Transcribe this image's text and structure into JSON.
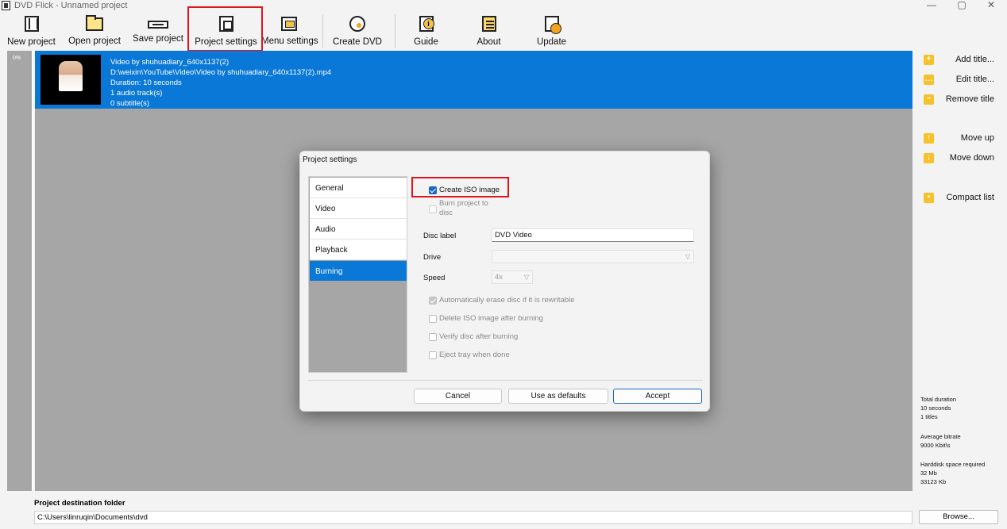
{
  "window": {
    "title": "DVD Flick - Unnamed project",
    "minimize": "—",
    "restore": "▢",
    "close": "✕"
  },
  "toolbar": {
    "new_project": "New project",
    "open_project": "Open project",
    "save_project": "Save project",
    "project_settings": "Project settings",
    "menu_settings": "Menu settings",
    "create_dvd": "Create DVD",
    "guide": "Guide",
    "about": "About",
    "update": "Update"
  },
  "progress": {
    "label": "0%",
    "value": 0
  },
  "title_item": {
    "name": "Video by shuhuadiary_640x1137(2)",
    "path": "D:\\weixin\\YouTube\\Video\\Video by shuhuadiary_640x1137(2).mp4",
    "duration": "Duration: 10 seconds",
    "audio": "1 audio track(s)",
    "subtitles": "0 subtitle(s)"
  },
  "sidebar": {
    "add_title": "Add title...",
    "edit_title": "Edit title...",
    "remove_title": "Remove title",
    "move_up": "Move up",
    "move_down": "Move down",
    "compact_list": "Compact list"
  },
  "stats": {
    "total_duration_label": "Total duration",
    "total_duration_value": "10 seconds",
    "titles": "1 titles",
    "bitrate_label": "Average bitrate",
    "bitrate_value": "9000 Kbit\\s",
    "disk_label": "Harddisk space required",
    "disk_mb": "32 Mb",
    "disk_kb": "33123 Kb"
  },
  "destination": {
    "label": "Project destination folder",
    "value": "C:\\Users\\linruqin\\Documents\\dvd",
    "browse": "Browse..."
  },
  "dialog": {
    "title": "Project settings",
    "nav": [
      "General",
      "Video",
      "Audio",
      "Playback",
      "Burning"
    ],
    "selected_nav": "Burning",
    "create_iso": {
      "label": "Create ISO image",
      "checked": true
    },
    "burn_project": {
      "label": "Burn project to disc",
      "checked": false
    },
    "disc_label": {
      "label": "Disc label",
      "value": "DVD Video"
    },
    "drive": {
      "label": "Drive",
      "value": ""
    },
    "speed": {
      "label": "Speed",
      "value": "4x"
    },
    "auto_erase": {
      "label": "Automatically erase disc if it is rewritable",
      "checked": true
    },
    "delete_iso": {
      "label": "Delete ISO image after burning",
      "checked": false
    },
    "verify": {
      "label": "Verify disc after burning",
      "checked": false
    },
    "eject": {
      "label": "Eject tray when done",
      "checked": false
    },
    "cancel": "Cancel",
    "use_defaults": "Use as defaults",
    "accept": "Accept"
  },
  "colors": {
    "selection_blue": "#0a78d7",
    "highlight_red": "#e0141e",
    "sidebar_icon": "#f6c12a",
    "list_bg": "#a6a6a6"
  }
}
